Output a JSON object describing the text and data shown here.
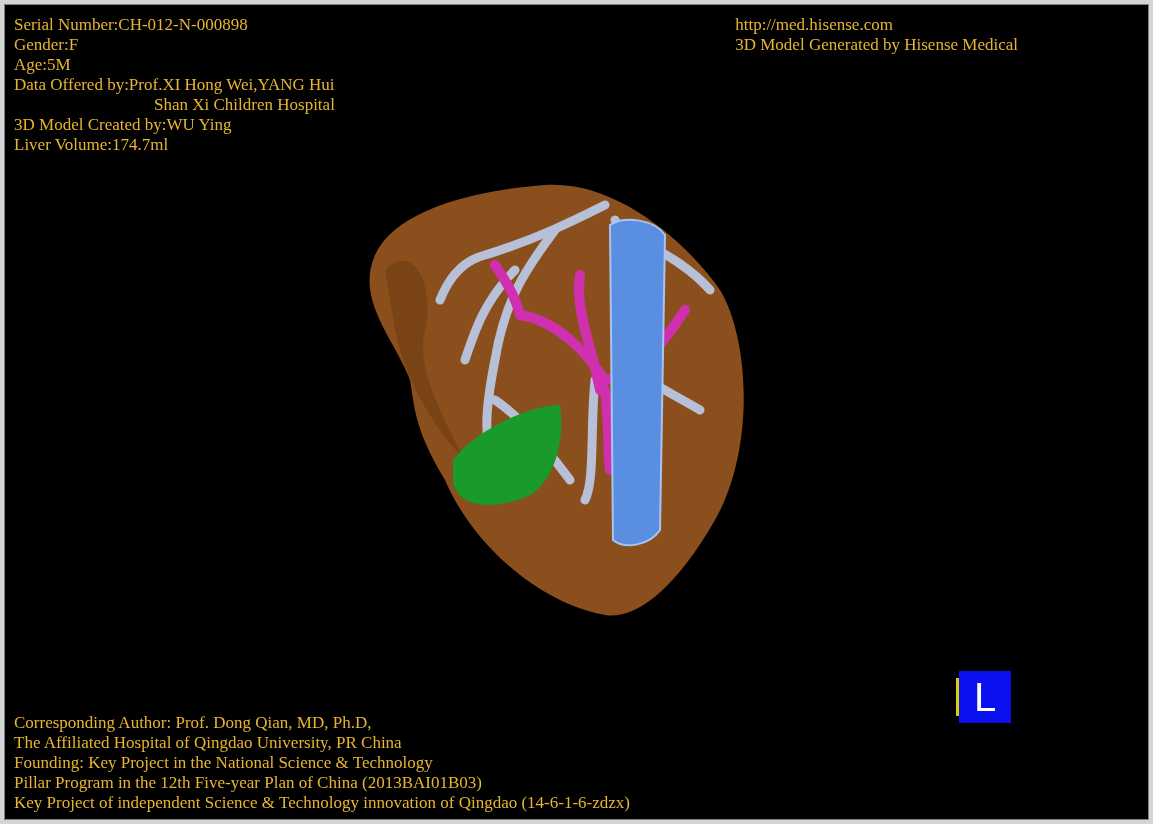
{
  "info_top_left": [
    {
      "kind": "line",
      "text": "Serial Number:CH-012-N-000898"
    },
    {
      "kind": "line",
      "text": "Gender:F"
    },
    {
      "kind": "line",
      "text": "Age:5M"
    },
    {
      "kind": "line",
      "text": "Data Offered by:Prof.XI Hong Wei,YANG Hui"
    },
    {
      "kind": "continuation",
      "text": "Shan Xi Children Hospital"
    },
    {
      "kind": "line",
      "text": "3D Model Created by:WU Ying"
    },
    {
      "kind": "line",
      "text": "Liver Volume:174.7ml"
    }
  ],
  "info_top_right": [
    "http://med.hisense.com",
    "3D Model Generated by Hisense Medical"
  ],
  "orientation_cube": {
    "label": "L"
  },
  "info_bottom_left": [
    "Corresponding Author: Prof. Dong Qian, MD, Ph.D,",
    "The Affiliated Hospital of Qingdao University, PR China",
    "Founding: Key Project in the National Science & Technology",
    "Pillar Program in the 12th Five-year Plan of China (2013BAI01B03)",
    "Key Project of independent Science & Technology innovation of Qingdao (14-6-1-6-zdzx)"
  ]
}
